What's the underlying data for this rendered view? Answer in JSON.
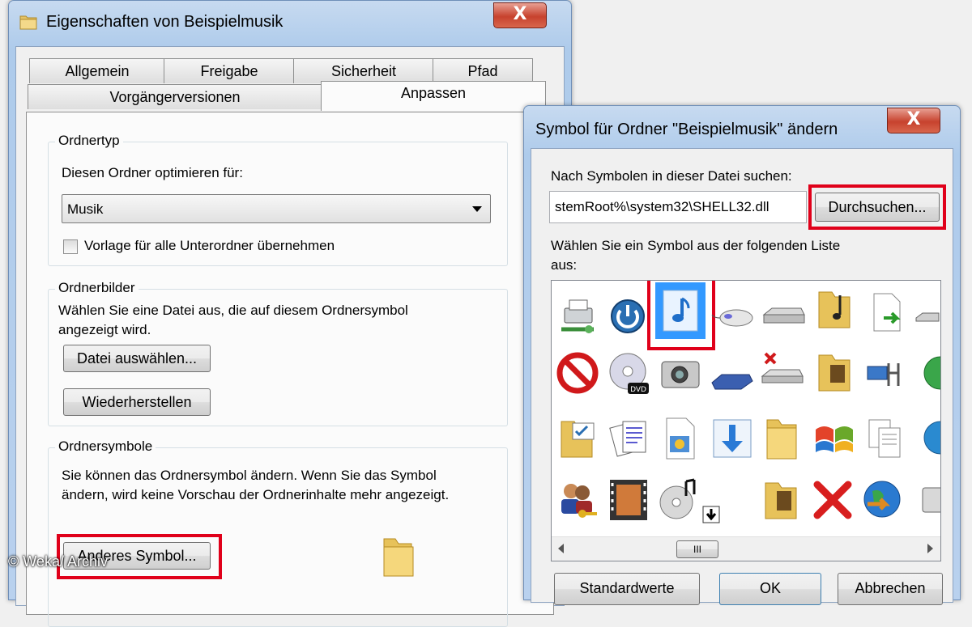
{
  "props_window": {
    "title": "Eigenschaften von Beispielmusik",
    "close_label": "X",
    "tabs_row_top": [
      "Allgemein",
      "Freigabe",
      "Sicherheit",
      "Pfad"
    ],
    "tabs_row_bottom": [
      "Vorgängerversionen",
      "Anpassen"
    ],
    "active_tab": "Anpassen",
    "folder_type": {
      "group_title": "Ordnertyp",
      "optimize_label": "Diesen Ordner optimieren für:",
      "optimize_value": "Musik",
      "template_checkbox_label": "Vorlage für alle Unterordner übernehmen"
    },
    "folder_pictures": {
      "group_title": "Ordnerbilder",
      "description_line1": "Wählen Sie eine Datei aus, die auf diesem Ordnersymbol",
      "description_line2": "angezeigt wird.",
      "choose_file_button": "Datei auswählen...",
      "restore_button": "Wiederherstellen"
    },
    "folder_icons": {
      "group_title": "Ordnersymbole",
      "description_line1": "Sie können das Ordnersymbol ändern. Wenn Sie das Symbol",
      "description_line2": "ändern, wird keine Vorschau der Ordnerinhalte mehr angezeigt.",
      "change_icon_button": "Anderes Symbol..."
    }
  },
  "icon_dialog": {
    "title": "Symbol für Ordner \"Beispielmusik\" ändern",
    "close_label": "X",
    "search_label": "Nach Symbolen in dieser Datei suchen:",
    "file_path": "stemRoot%\\system32\\SHELL32.dll",
    "browse_button": "Durchsuchen...",
    "list_label_line1": "Wählen Sie ein Symbol aus der folgenden Liste",
    "list_label_line2": "aus:",
    "scroll_thumb": "III",
    "buttons": [
      "Standardwerte",
      "OK",
      "Abbrechen"
    ]
  },
  "watermark": "© Weka/ Archiv",
  "colors": {
    "highlight_red": "#e0001a",
    "selection_blue": "#3399ff"
  }
}
